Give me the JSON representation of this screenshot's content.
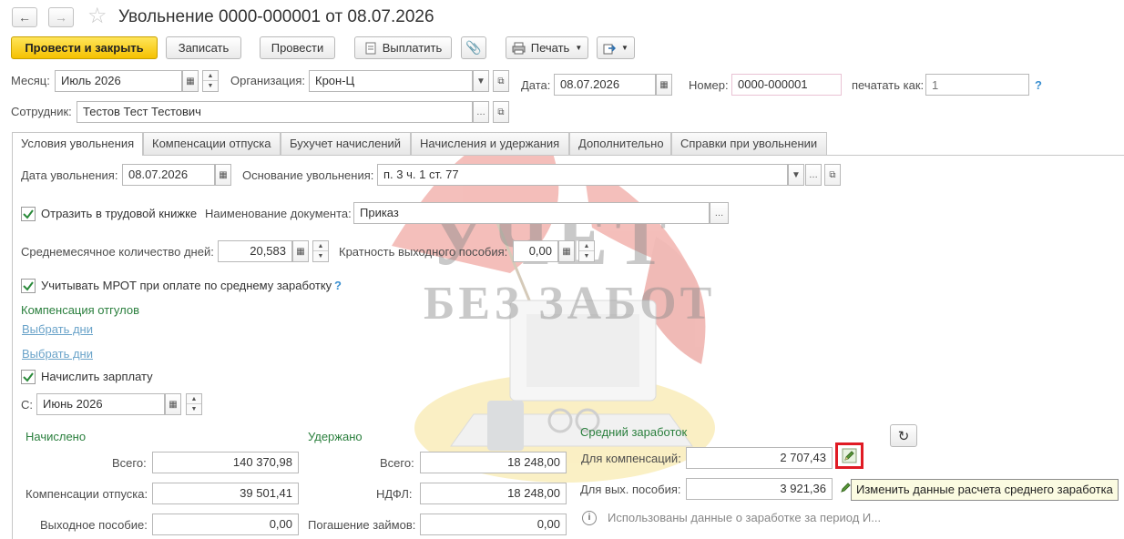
{
  "header": {
    "title": "Увольнение 0000-000001 от 08.07.2026",
    "back_icon": "arrow-left",
    "forward_icon": "arrow-right",
    "favorite_icon": "star"
  },
  "toolbar": {
    "post_close_label": "Провести и закрыть",
    "save_label": "Записать",
    "post_label": "Провести",
    "pay_label": "Выплатить",
    "print_label": "Печать"
  },
  "header_fields": {
    "month_label": "Месяц:",
    "month_value": "Июль 2026",
    "org_label": "Организация:",
    "org_value": "Крон-Ц",
    "date_label": "Дата:",
    "date_value": "08.07.2026",
    "number_label": "Номер:",
    "number_value": "0000-000001",
    "print_as_label": "печатать как:",
    "print_as_placeholder": "1",
    "help": "?",
    "employee_label": "Сотрудник:",
    "employee_value": "Тестов Тест Тестович"
  },
  "tabs": [
    {
      "label": "Условия увольнения",
      "active": true
    },
    {
      "label": "Компенсации отпуска",
      "active": false
    },
    {
      "label": "Бухучет начислений",
      "active": false
    },
    {
      "label": "Начисления и удержания",
      "active": false
    },
    {
      "label": "Дополнительно",
      "active": false
    },
    {
      "label": "Справки при увольнении",
      "active": false
    }
  ],
  "conditions": {
    "dismissal_date_label": "Дата увольнения:",
    "dismissal_date_value": "08.07.2026",
    "reason_label": "Основание увольнения:",
    "reason_value": "п. 3 ч. 1 ст. 77",
    "reflect_label": "Отразить в трудовой книжке",
    "reflect_checked": true,
    "doc_name_label": "Наименование документа:",
    "doc_name_value": "Приказ",
    "avg_days_label": "Среднемесячное количество дней:",
    "avg_days_value": "20,583",
    "multiplicity_label": "Кратность выходного пособия:",
    "multiplicity_value": "0,00",
    "mrot_label": "Учитывать МРОТ при оплате по среднему заработку",
    "mrot_checked": true,
    "mrot_help": "?",
    "comp_days_off_label": "Компенсация отгулов",
    "choose_days_1": "Выбрать дни",
    "choose_days_2": "Выбрать дни",
    "salary_label": "Начислить зарплату",
    "salary_checked": true,
    "from_label": "С:",
    "from_value": "Июнь 2026"
  },
  "accrued": {
    "title": "Начислено",
    "total_label": "Всего:",
    "total_value": "140 370,98",
    "vacation_comp_label": "Компенсации отпуска:",
    "vacation_comp_value": "39 501,41",
    "severance_label": "Выходное пособие:",
    "severance_value": "0,00"
  },
  "withheld": {
    "title": "Удержано",
    "total_label": "Всего:",
    "total_value": "18 248,00",
    "ndfl_label": "НДФЛ:",
    "ndfl_value": "18 248,00",
    "loans_label": "Погашение займов:",
    "loans_value": "0,00"
  },
  "average": {
    "title": "Средний заработок",
    "comp_label": "Для компенсаций:",
    "comp_value": "2 707,43",
    "severance_label": "Для вых. пособия:",
    "severance_value": "3 921,36",
    "info_text": "Использованы данные о заработке за период И...",
    "tooltip": "Изменить данные расчета среднего заработка"
  },
  "watermark": {
    "line1": "УЧЕТ",
    "line2": "БЕЗ ЗАБОТ"
  },
  "colors": {
    "accent_yellow": "#f5c100",
    "label_green": "#2a7f3d",
    "link_blue": "#6aa3c9",
    "highlight_red": "#e01b24"
  }
}
